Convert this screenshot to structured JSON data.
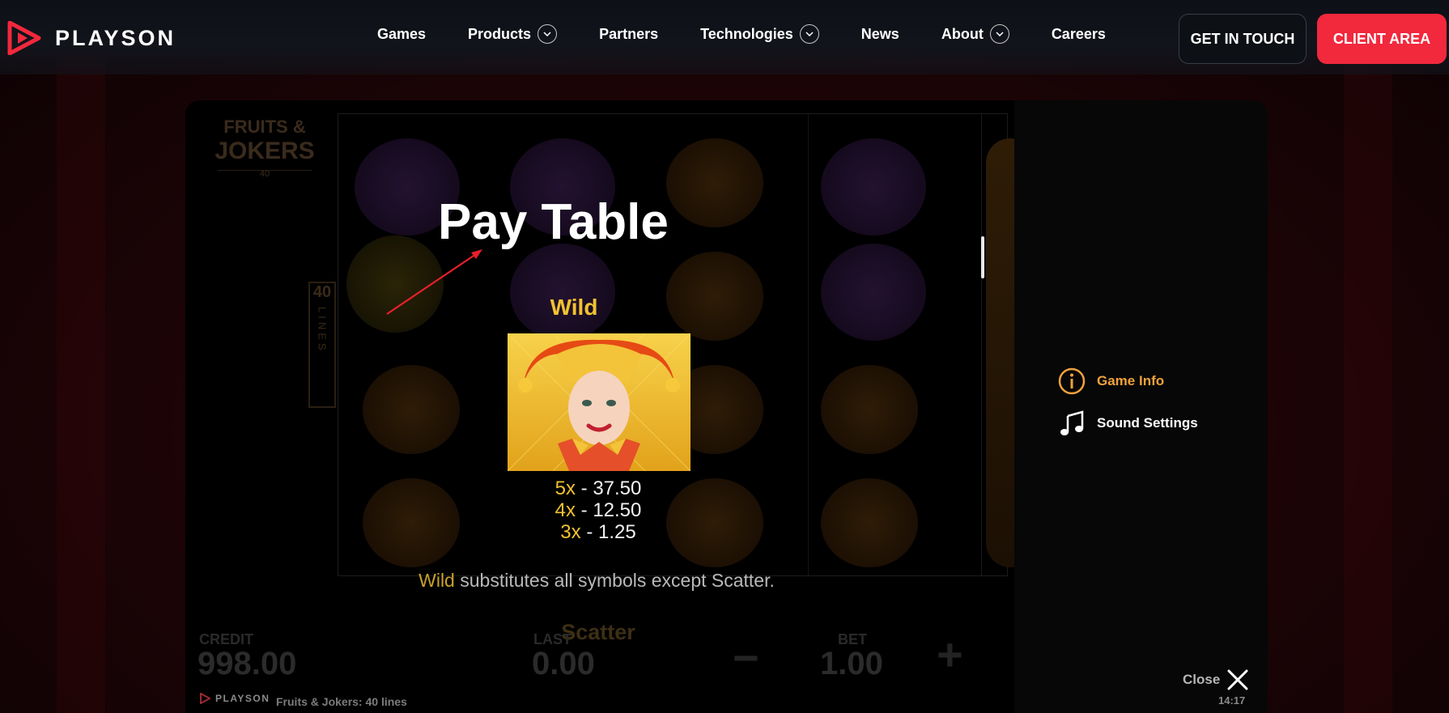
{
  "header": {
    "brand": "PLAYSON",
    "nav": [
      {
        "label": "Games",
        "dropdown": false
      },
      {
        "label": "Products",
        "dropdown": true
      },
      {
        "label": "Partners",
        "dropdown": false
      },
      {
        "label": "Technologies",
        "dropdown": true
      },
      {
        "label": "News",
        "dropdown": false
      },
      {
        "label": "About",
        "dropdown": true
      },
      {
        "label": "Careers",
        "dropdown": false
      }
    ],
    "get_in_touch": "GET IN TOUCH",
    "client_area": "CLIENT AREA"
  },
  "game": {
    "logo_title_1": "FRUITS &",
    "logo_title_2": "JOKERS",
    "logo_sub": "40",
    "lines_count": "40",
    "lines_word": "LINES",
    "pay_table_title": "Pay Table",
    "symbol": {
      "name": "Wild",
      "pays": [
        {
          "mult": "5x",
          "value": "37.50"
        },
        {
          "mult": "4x",
          "value": "12.50"
        },
        {
          "mult": "3x",
          "value": "1.25"
        }
      ],
      "desc_highlight": "Wild",
      "desc_rest": " substitutes all symbols except Scatter."
    },
    "next_symbol": "Scatter",
    "hud": {
      "credit_label": "CREDIT",
      "credit_value": "998.00",
      "last_label": "LAST",
      "last_value": "0.00",
      "bet_label": "BET",
      "bet_value": "1.00",
      "minus": "−",
      "plus": "+"
    },
    "footer_brand": "PLAYSON",
    "footer_game": "Fruits & Jokers: 40 lines"
  },
  "menu": {
    "game_info": "Game Info",
    "sound_settings": "Sound Settings",
    "close": "Close",
    "clock": "14:17"
  },
  "colors": {
    "accent_red": "#f2283d",
    "gold": "#f2c230",
    "menu_active": "#f0a23c"
  }
}
